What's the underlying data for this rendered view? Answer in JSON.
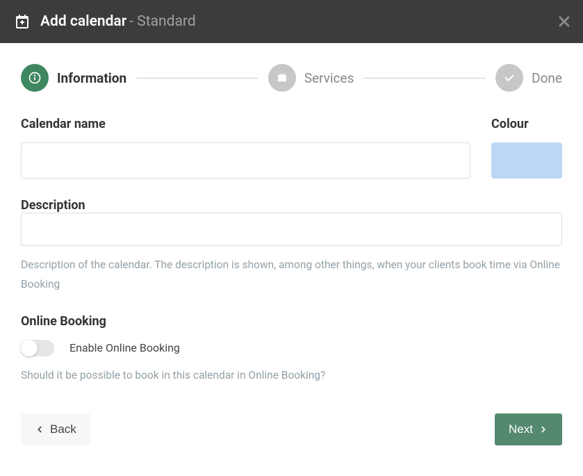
{
  "header": {
    "title": "Add calendar",
    "subtitle": "- Standard"
  },
  "stepper": {
    "steps": [
      {
        "label": "Information"
      },
      {
        "label": "Services"
      },
      {
        "label": "Done"
      }
    ]
  },
  "fields": {
    "name_label": "Calendar name",
    "colour_label": "Colour",
    "colour_value": "#bcd7f5",
    "description_label": "Description",
    "description_help": "Description of the calendar. The description is shown, among other things, when your clients book time via Online Booking"
  },
  "online_booking": {
    "heading": "Online Booking",
    "toggle_label": "Enable Online Booking",
    "help": "Should it be possible to book in this calendar in Online Booking?"
  },
  "buttons": {
    "back": "Back",
    "next": "Next"
  }
}
